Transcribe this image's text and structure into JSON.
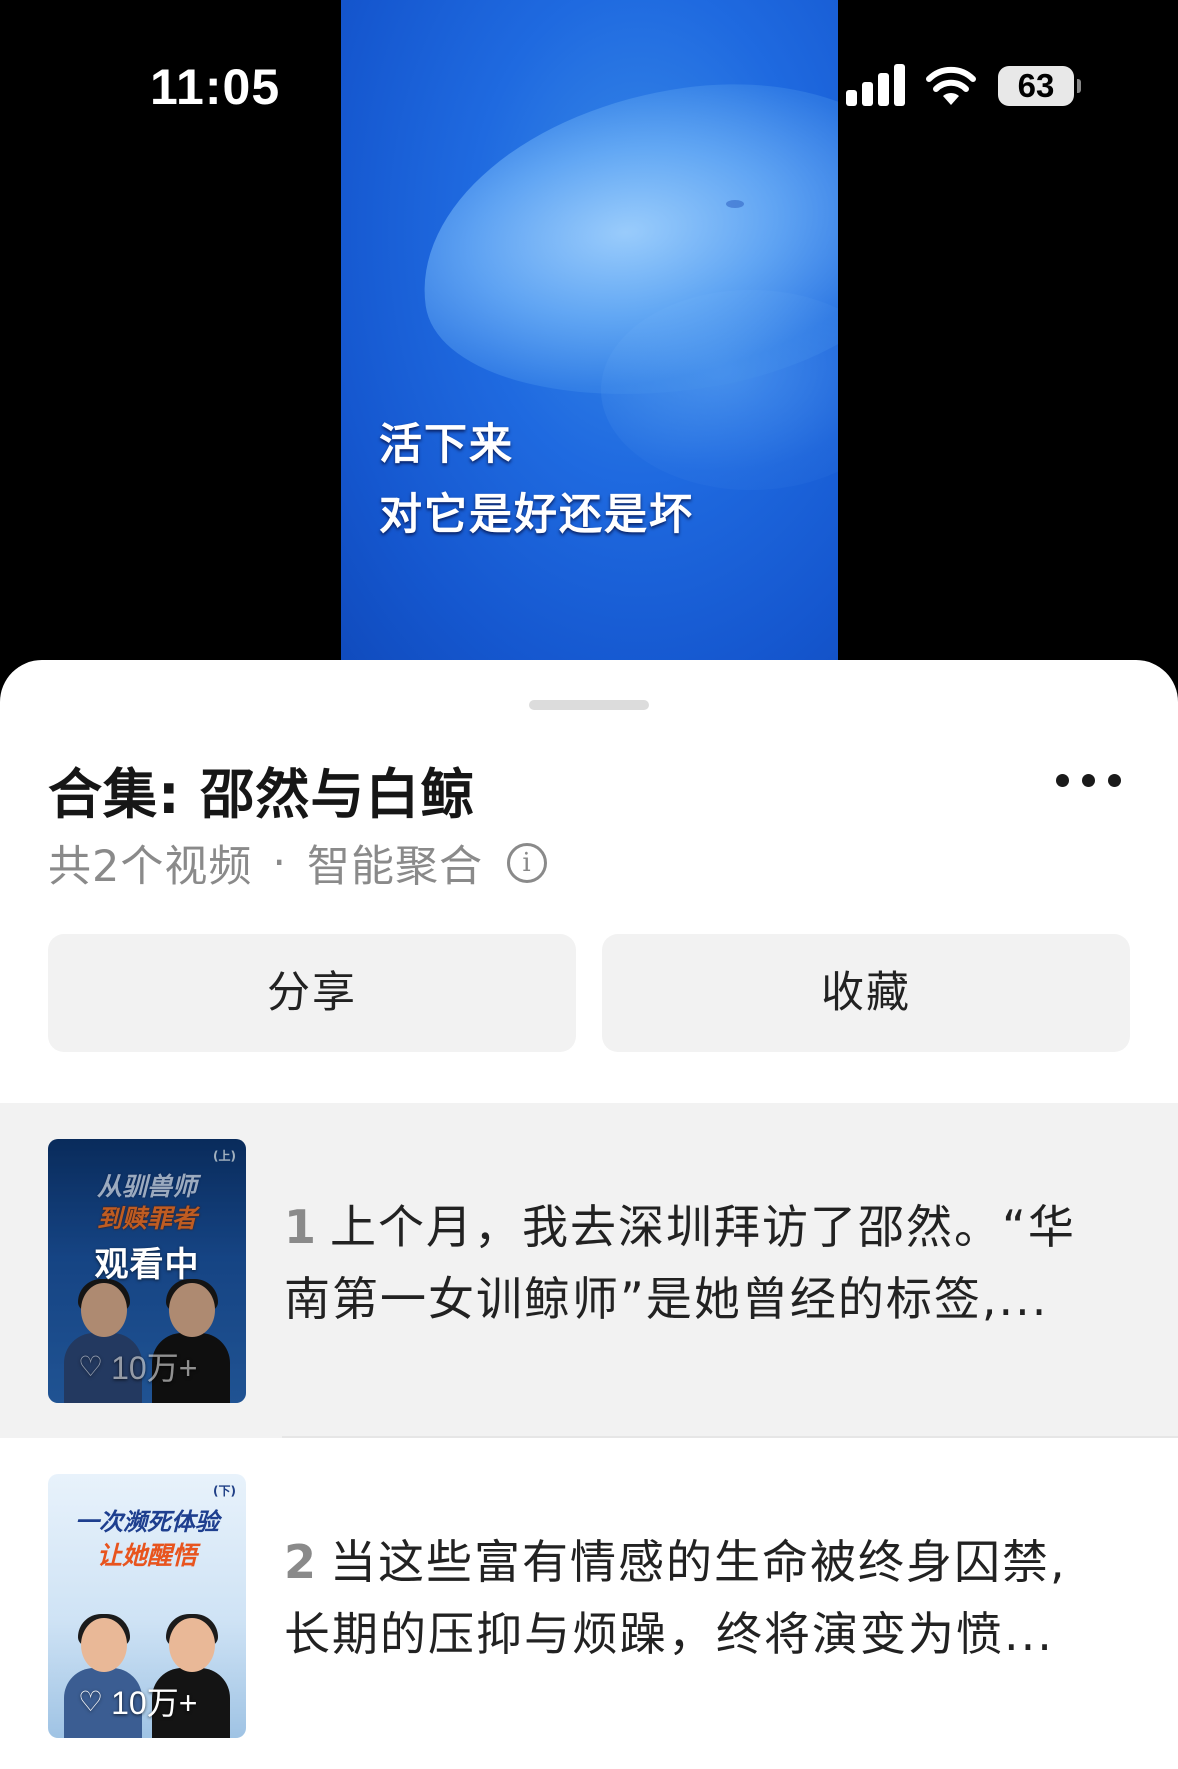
{
  "status_bar": {
    "time": "11:05",
    "battery": "63",
    "signal_icon": "cellular-signal-icon",
    "wifi_icon": "wifi-icon"
  },
  "video": {
    "subtitle_line1": "活下来",
    "subtitle_line2": "对它是好还是坏",
    "background_color": "#1f6ae0"
  },
  "sheet": {
    "title": "合集: 邵然与白鲸",
    "subtitle_count": "共2个视频",
    "subtitle_dot": "·",
    "subtitle_type": "智能聚合",
    "info_icon": "ⓘ",
    "share_label": "分享",
    "favorite_label": "收藏"
  },
  "items": [
    {
      "index": "1",
      "line1": "上个月，我去深圳拜访了邵然。“华",
      "line2": "南第一女训鲸师”是她曾经的标签,...",
      "thumb_tag": "(上)",
      "thumb_headline1": "从驯兽师",
      "thumb_headline2": "到赎罪者",
      "watching_label": "观看中",
      "likes": "10万+"
    },
    {
      "index": "2",
      "line1": "当这些富有情感的生命被终身囚禁,",
      "line2": "长期的压抑与烦躁，终将演变为愤...",
      "thumb_tag": "(下)",
      "thumb_headline1": "一次濒死体验",
      "thumb_headline2": "让她醒悟",
      "likes": "10万+"
    }
  ]
}
